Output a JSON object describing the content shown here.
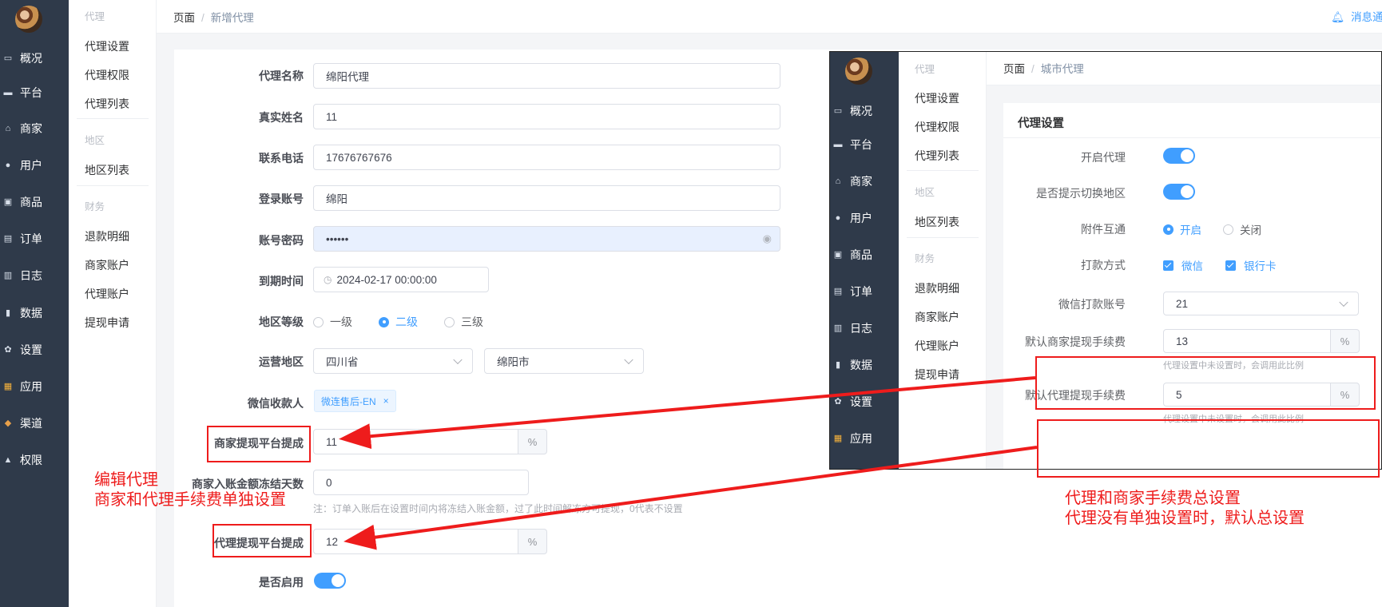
{
  "nav": {
    "items": [
      {
        "label": "概况",
        "icon": "monitor-chart-icon"
      },
      {
        "label": "平台",
        "icon": "desktop-icon"
      },
      {
        "label": "商家",
        "icon": "store-icon"
      },
      {
        "label": "用户",
        "icon": "user-icon"
      },
      {
        "label": "商品",
        "icon": "goods-icon"
      },
      {
        "label": "订单",
        "icon": "order-icon"
      },
      {
        "label": "日志",
        "icon": "log-icon"
      },
      {
        "label": "数据",
        "icon": "bar-chart-icon"
      },
      {
        "label": "设置",
        "icon": "gear-icon"
      },
      {
        "label": "应用",
        "icon": "apps-icon"
      },
      {
        "label": "渠道",
        "icon": "cube-icon"
      },
      {
        "label": "权限",
        "icon": "lock-icon"
      }
    ]
  },
  "subnav": {
    "sec1": "代理",
    "items1": [
      "代理设置",
      "代理权限",
      "代理列表"
    ],
    "sec2": "地区",
    "items2": [
      "地区列表"
    ],
    "sec3": "财务",
    "items3": [
      "退款明细",
      "商家账户",
      "代理账户",
      "提现申请"
    ]
  },
  "header": {
    "crumb1": "页面",
    "crumb2": "新增代理",
    "notice": "消息通"
  },
  "form": {
    "name_label": "代理名称",
    "name_value": "绵阳代理",
    "realname_label": "真实姓名",
    "realname_value": "11",
    "phone_label": "联系电话",
    "phone_value": "17676767676",
    "account_label": "登录账号",
    "account_value": "绵阳",
    "password_label": "账号密码",
    "password_value": "••••••",
    "expire_label": "到期时间",
    "expire_value": "2024-02-17 00:00:00",
    "level_label": "地区等级",
    "level_options": [
      "一级",
      "二级",
      "三级"
    ],
    "level_selected": "二级",
    "region_label": "运营地区",
    "province": "四川省",
    "city": "绵阳市",
    "wechat_label": "微信收款人",
    "wechat_tag": "微连售后-EN",
    "merchant_fee_label": "商家提现平台提成",
    "merchant_fee_value": "11",
    "percent": "%",
    "freeze_label": "商家入账金额冻结天数",
    "freeze_value": "0",
    "freeze_note": "注：订单入账后在设置时间内将冻结入账金额，过了此时间解冻方可提现，0代表不设置",
    "agent_fee_label": "代理提现平台提成",
    "agent_fee_value": "12",
    "enable_label": "是否启用",
    "enable_on": true
  },
  "inset": {
    "crumb1": "页面",
    "crumb2": "城市代理",
    "card_title": "代理设置",
    "open_label": "开启代理",
    "switch_label": "是否提示切换地区",
    "attach_label": "附件互通",
    "attach_on": "开启",
    "attach_off": "关闭",
    "pay_label": "打款方式",
    "pay_wechat": "微信",
    "pay_bank": "银行卡",
    "wx_account_label": "微信打款账号",
    "wx_account_value": "21",
    "def_merchant_label": "默认商家提现手续费",
    "def_merchant_value": "13",
    "def_agent_label": "默认代理提现手续费",
    "def_agent_value": "5",
    "hint": "代理设置中未设置时，会调用此比例",
    "percent": "%"
  },
  "annotations": {
    "left_line1": "编辑代理",
    "left_line2": "商家和代理手续费单独设置",
    "right_line1": "代理和商家手续费总设置",
    "right_line2": "代理没有单独设置时，默认总设置"
  },
  "colors": {
    "sidebar": "#2f3a4a",
    "primary": "#409eff",
    "annotation": "#ee1c1c"
  }
}
